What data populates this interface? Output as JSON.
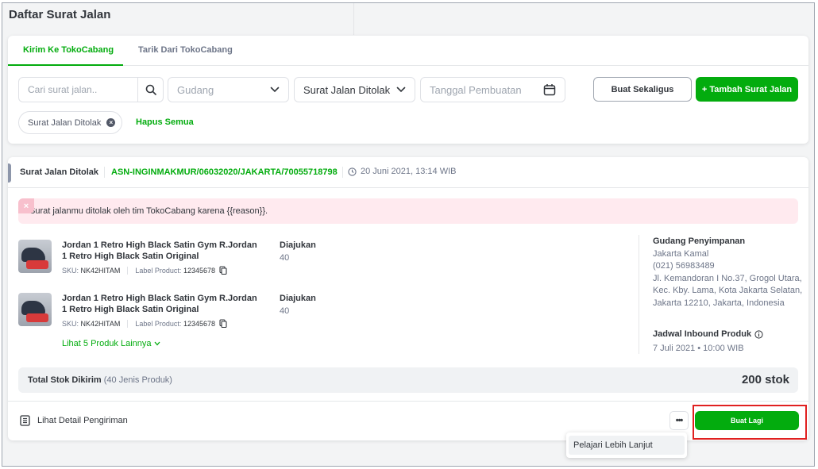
{
  "page": {
    "title": "Daftar Surat Jalan"
  },
  "tabs": [
    {
      "label": "Kirim Ke TokoCabang",
      "active": true
    },
    {
      "label": "Tarik Dari TokoCabang",
      "active": false
    }
  ],
  "filters": {
    "search_placeholder": "Cari surat jalan..",
    "warehouse_placeholder": "Gudang",
    "status_value": "Surat Jalan Ditolak",
    "date_placeholder": "Tanggal Pembuatan",
    "bulk_button": "Buat Sekaligus",
    "add_button": "+ Tambah Surat Jalan",
    "active_chip": "Surat Jalan Ditolak",
    "clear_all": "Hapus Semua"
  },
  "shipment": {
    "status": "Surat Jalan Ditolak",
    "asn": "ASN-INGINMAKMUR/06032020/JAKARTA/70055718798",
    "created_at": "20 Juni 2021, 13:14 WIB",
    "alert": "Surat jalanmu ditolak oleh tim TokoCabang karena {{reason}}.",
    "products": [
      {
        "name": "Jordan 1 Retro High Black Satin Gym R.Jordan 1 Retro High Black Satin Original",
        "sku_label": "SKU:",
        "sku": "NK42HITAM",
        "product_label": "Label Product:",
        "label_product": "12345678",
        "qty_label": "Diajukan",
        "qty": "40"
      },
      {
        "name": "Jordan 1 Retro High Black Satin Gym R.Jordan 1 Retro High Black Satin Original",
        "sku_label": "SKU:",
        "sku": "NK42HITAM",
        "product_label": "Label Product:",
        "label_product": "12345678",
        "qty_label": "Diajukan",
        "qty": "40"
      }
    ],
    "more_products": "Lihat 5 Produk Lainnya",
    "warehouse": {
      "title": "Gudang Penyimpanan",
      "name": "Jakarta Kamal",
      "phone": "(021) 56983489",
      "address": "Jl. Kemandoran I No.37, Grogol Utara, Kec. Kby. Lama, Kota Jakarta Selatan, Jakarta 12210, Jakarta, Indonesia"
    },
    "schedule": {
      "title": "Jadwal Inbound Produk",
      "value": "7 Juli 2021 • 10:00 WIB"
    },
    "total": {
      "label": "Total Stok Dikirim",
      "detail": "(40 Jenis Produk)",
      "value": "200 stok"
    },
    "detail_link": "Lihat Detail Pengiriman",
    "more_button": "•••",
    "repeat_button": "Buat Lagi",
    "dropdown_item": "Pelajari Lebih Lanjut"
  },
  "colors": {
    "accent": "#03ac0e",
    "alert_bg": "#ffeaef",
    "highlight": "#e02020"
  }
}
